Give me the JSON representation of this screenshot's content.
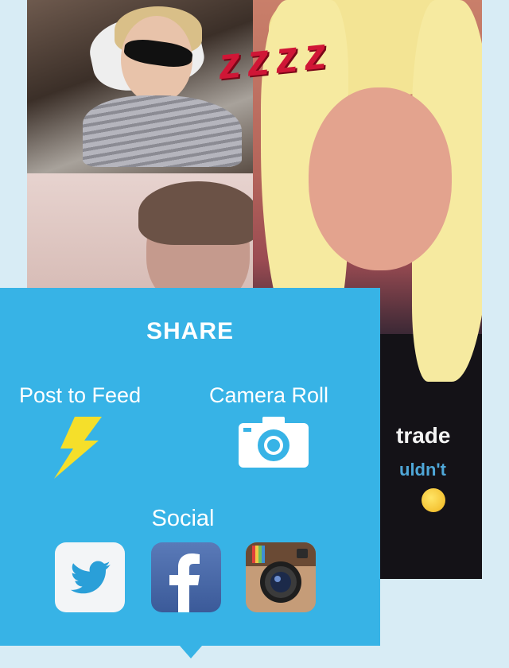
{
  "background": {
    "overlay_text_line1": "trade",
    "overlay_text_line2": "uldn't",
    "sleep_text": "zzzz"
  },
  "share_panel": {
    "title": "SHARE",
    "post_to_feed_label": "Post to Feed",
    "camera_roll_label": "Camera Roll",
    "social_label": "Social",
    "social_icons": [
      "twitter-icon",
      "facebook-icon",
      "instagram-icon"
    ],
    "colors": {
      "panel": "#37b3e6",
      "bolt": "#f5df2a",
      "text": "#ffffff"
    }
  }
}
